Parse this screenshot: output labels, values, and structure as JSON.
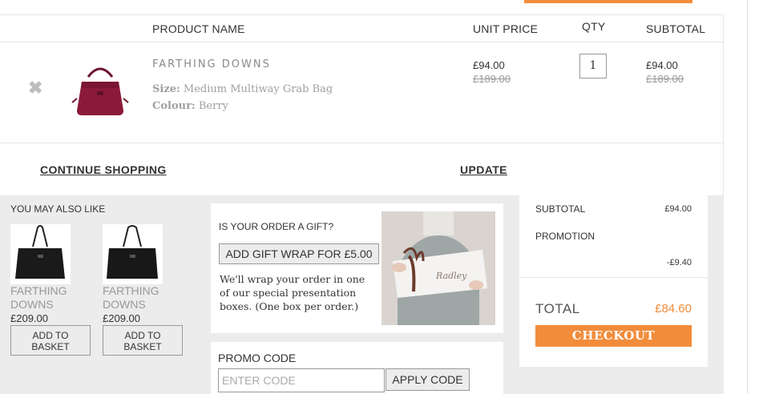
{
  "header": {
    "product_name": "PRODUCT NAME",
    "unit_price": "UNIT PRICE",
    "qty": "QTY",
    "subtotal": "SUBTOTAL"
  },
  "item": {
    "remove_glyph": "✖",
    "remove_icon": "close-icon",
    "name": "FARTHING DOWNS",
    "size_label": "Size:",
    "size_value": "Medium Multiway Grab Bag",
    "colour_label": "Colour:",
    "colour_value": "Berry",
    "unit_price": "£94.00",
    "unit_price_old": "£189.00",
    "qty": "1",
    "subtotal": "£94.00",
    "subtotal_old": "£189.00",
    "bag_color": "#8b1a3a"
  },
  "actions": {
    "continue_shopping": "CONTINUE SHOPPING",
    "update": "UPDATE"
  },
  "recommendations": {
    "heading": "YOU MAY ALSO LIKE",
    "items": [
      {
        "name_line1": "FARTHING",
        "name_line2": "DOWNS",
        "price": "£209.00",
        "btn_line1": "ADD TO",
        "btn_line2": "BASKET"
      },
      {
        "name_line1": "FARTHING",
        "name_line2": "DOWNS",
        "price": "£209.00",
        "btn_line1": "ADD TO",
        "btn_line2": "BASKET"
      }
    ]
  },
  "gift": {
    "question": "IS YOUR ORDER A GIFT?",
    "button": "ADD GIFT WRAP FOR £5.00",
    "text": "We'll wrap your order in one of our special presentation boxes. (One box per order.)",
    "box_script": "Radley"
  },
  "promo": {
    "label": "PROMO CODE",
    "placeholder": "ENTER CODE",
    "button": "APPLY CODE"
  },
  "summary": {
    "subtotal_label": "SUBTOTAL",
    "subtotal_value": "£94.00",
    "promotion_label": "PROMOTION",
    "promotion_value": "-£9.40",
    "total_label": "TOTAL",
    "total_value": "£84.60",
    "checkout": "CHECKOUT"
  },
  "colors": {
    "accent": "#f28c3b",
    "panel_grey": "#ececec"
  }
}
